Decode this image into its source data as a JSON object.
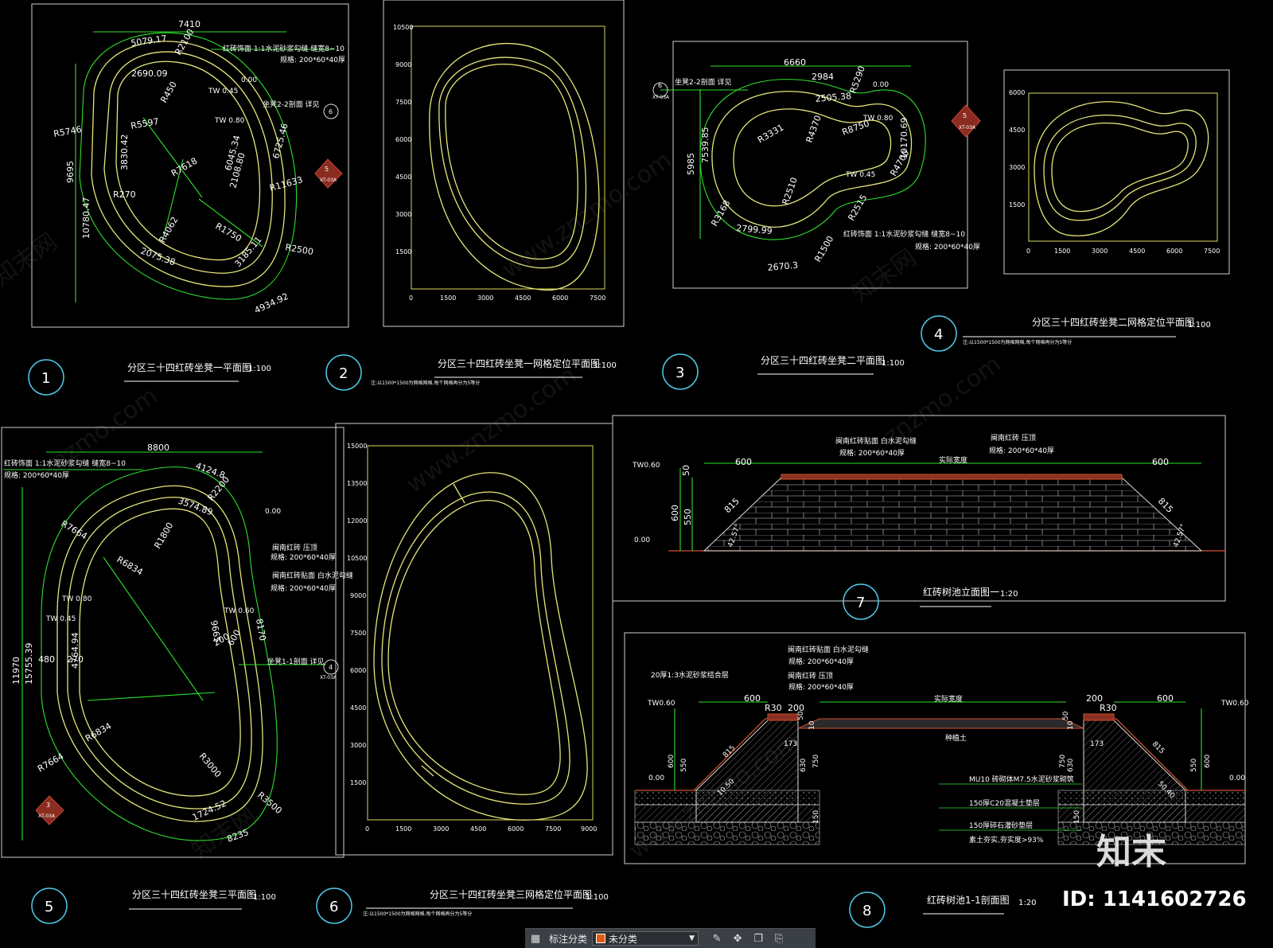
{
  "titles": {
    "t1": "分区三十四红砖坐凳一平面图",
    "t2": "分区三十四红砖坐凳一网格定位平面图",
    "t3": "分区三十四红砖坐凳二平面图",
    "t4": "分区三十四红砖坐凳二网格定位平面图",
    "t5": "分区三十四红砖坐凳三平面图",
    "t6": "分区三十四红砖坐凳三网格定位平面图",
    "t7": "红砖树池立面图一",
    "t8": "红砖树池1-1剖面图"
  },
  "scales": {
    "s100": "1:100",
    "s20": "1:20"
  },
  "numbers": [
    "1",
    "2",
    "3",
    "4",
    "5",
    "6",
    "7",
    "8"
  ],
  "grid_note": "注:以1500*1500为网格网格,每个网格再分为5等分",
  "grid_ticks": {
    "g2_y": [
      "10500",
      "9000",
      "7500",
      "6000",
      "4500",
      "3000",
      "1500"
    ],
    "g2_x": [
      "0",
      "1500",
      "3000",
      "4500",
      "6000",
      "7500"
    ],
    "g4_y": [
      "6000",
      "4500",
      "3000",
      "1500"
    ],
    "g4_x": [
      "0",
      "1500",
      "3000",
      "4500",
      "6000",
      "7500"
    ],
    "g6_y": [
      "15000",
      "13500",
      "12000",
      "10500",
      "9000",
      "7500",
      "6000",
      "4500",
      "3000",
      "1500"
    ],
    "g6_x": [
      "0",
      "1500",
      "3000",
      "4500",
      "6000",
      "7500",
      "9000"
    ]
  },
  "plan1": {
    "dims": [
      "7410",
      "5079.17",
      "R2100",
      "2690.09",
      "R450",
      "R5597",
      "R7618",
      "R5746",
      "9695",
      "10780.47",
      "3830.42",
      "R270",
      "R4062",
      "R1750",
      "R11633",
      "R2500",
      "4934.92",
      "6725.46",
      "6045.34",
      "2108.80",
      "3185.11",
      "2075.38"
    ],
    "labels": [
      "红砖饰面 1:1水泥砂浆勾缝 缝宽8~10",
      "规格: 200*60*40厚",
      "TW 0.45",
      "TW 0.80",
      "0.00",
      "坐凳2-2剖面 详见"
    ],
    "callout_a": "6",
    "callout_b": "5",
    "ref": "XT-03A"
  },
  "plan3": {
    "dims": [
      "6660",
      "2984",
      "R5290",
      "2505.38",
      "R4370",
      "R8750",
      "R3331",
      "R2510",
      "R4700",
      "R2515",
      "R3168",
      "2799.99",
      "2670.3",
      "R1500",
      "5985",
      "7539.85",
      "10170.69"
    ],
    "labels": [
      "坐凳2-2剖面 详见",
      "TW 0.80",
      "TW 0.45",
      "0.00",
      "红砖饰面 1:1水泥砂浆勾缝 缝宽8~10",
      "规格: 200*60*40厚"
    ],
    "callout_a": "6",
    "callout_b": "5",
    "ref": "XT-03A"
  },
  "plan5": {
    "dims": [
      "8800",
      "4124.8",
      "R2200",
      "3574.89",
      "R1800",
      "R7664",
      "R6834",
      "11970",
      "15755.39",
      "4764.94",
      "R6834",
      "R7664",
      "R3000",
      "R3500",
      "1724.52",
      "8235",
      "9665",
      "8170",
      "200",
      "600",
      "480",
      "270"
    ],
    "labels": [
      "红砖饰面 1:1水泥砂浆勾缝 缝宽8~10",
      "规格: 200*60*40厚",
      "0.00",
      "闽南红砖 压顶",
      "规格: 200*60*40厚",
      "闽南红砖贴面 白水泥勾缝",
      "规格: 200*60*40厚",
      "TW 0.80",
      "TW 0.45",
      "TW 0.60",
      "坐凳1-1剖面 详见"
    ],
    "callout_a": "4",
    "callout_b": "3",
    "ref": "XT-03A"
  },
  "elev7": {
    "labels": [
      "闽南红砖贴面 白水泥勾缝",
      "规格: 200*60*40厚",
      "闽南红砖 压顶",
      "规格: 200*60*40厚",
      "实际宽度",
      "TW0.60",
      "0.00"
    ],
    "dims": [
      "600",
      "600",
      "50",
      "600",
      "550",
      "815",
      "815",
      "42.57°",
      "42.57°"
    ]
  },
  "sect8": {
    "labels": [
      "闽南红砖贴面 白水泥勾缝",
      "规格: 200*60*40厚",
      "闽南红砖 压顶",
      "规格: 200*60*40厚",
      "20厚1:3水泥砂浆结合层",
      "实际宽度",
      "种植土",
      "MU10 砖砌体M7.5水泥砂浆砌筑",
      "150厚C20混凝土垫层",
      "150厚碎石灌砂垫层",
      "素土夯实,夯实度>93%",
      "TW0.60",
      "TW0.60",
      "0.00",
      "0.00"
    ],
    "dims": [
      "600",
      "600",
      "R30",
      "R30",
      "200",
      "200",
      "173",
      "173",
      "10",
      "10",
      "50",
      "50",
      "630",
      "630",
      "750",
      "750",
      "150",
      "150",
      "600",
      "550",
      "600",
      "550",
      "815",
      "815",
      "10.50",
      "50.40"
    ]
  },
  "watermarks": [
    "znzmo.com",
    "www.znzmo.com",
    "知末网"
  ],
  "brand": {
    "logo": "知末",
    "id": "ID: 1141602726"
  },
  "toolbar": {
    "label": "标注分类",
    "selected": "未分类"
  }
}
